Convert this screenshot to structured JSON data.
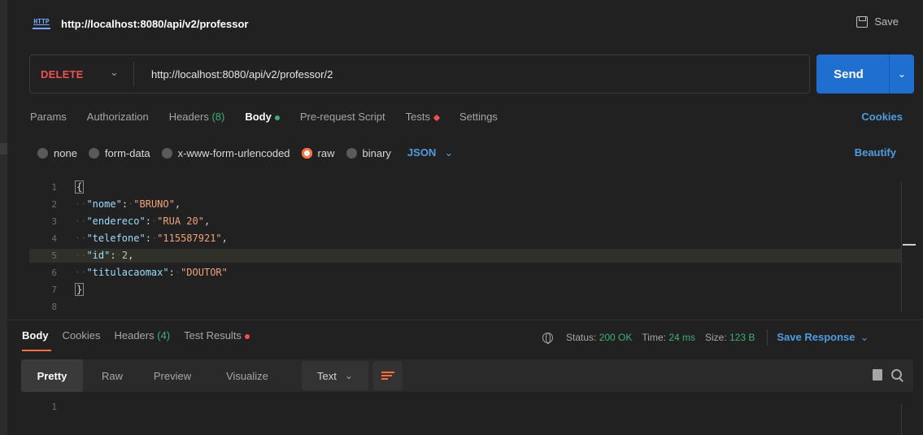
{
  "window": {
    "title": "http://localhost:8080/api/v2/professor",
    "save_label": "Save",
    "http_icon_text": "HTTP"
  },
  "request": {
    "method": "DELETE",
    "url": "http://localhost:8080/api/v2/professor/2",
    "send_label": "Send"
  },
  "tabs": {
    "params": "Params",
    "authorization": "Authorization",
    "headers": "Headers",
    "headers_count": "(8)",
    "body": "Body",
    "prerequest": "Pre-request Script",
    "tests": "Tests",
    "settings": "Settings",
    "cookies": "Cookies"
  },
  "body_type": {
    "none": "none",
    "form_data": "form-data",
    "urlencoded": "x-www-form-urlencoded",
    "raw": "raw",
    "binary": "binary",
    "format": "JSON",
    "beautify": "Beautify"
  },
  "editor": {
    "line_numbers": [
      "1",
      "2",
      "3",
      "4",
      "5",
      "6",
      "7",
      "8"
    ],
    "open_brace": "{",
    "close_brace": "}",
    "fields": [
      {
        "key": "\"nome\"",
        "value": "\"BRUNO\"",
        "trail": ","
      },
      {
        "key": "\"endereco\"",
        "value": "\"RUA 20\"",
        "trail": ","
      },
      {
        "key": "\"telefone\"",
        "value": "\"115587921\"",
        "trail": ","
      },
      {
        "key": "\"id\"",
        "value": "2",
        "trail": ","
      },
      {
        "key": "\"titulacaomax\"",
        "value": "\"DOUTOR\"",
        "trail": ""
      }
    ]
  },
  "response": {
    "tabs": {
      "body": "Body",
      "cookies": "Cookies",
      "headers": "Headers",
      "headers_count": "(4)",
      "test_results": "Test Results"
    },
    "status_label": "Status:",
    "status_value": "200 OK",
    "time_label": "Time:",
    "time_value": "24 ms",
    "size_label": "Size:",
    "size_value": "123 B",
    "save_response": "Save Response",
    "views": {
      "pretty": "Pretty",
      "raw": "Raw",
      "preview": "Preview",
      "visualize": "Visualize"
    },
    "text_format": "Text",
    "line_numbers": [
      "1"
    ]
  },
  "colors": {
    "accent_orange": "#ff6c37",
    "send_blue": "#1f6fd1",
    "link_blue": "#4d9de0",
    "status_green": "#3bb273",
    "method_red": "#f05050"
  }
}
